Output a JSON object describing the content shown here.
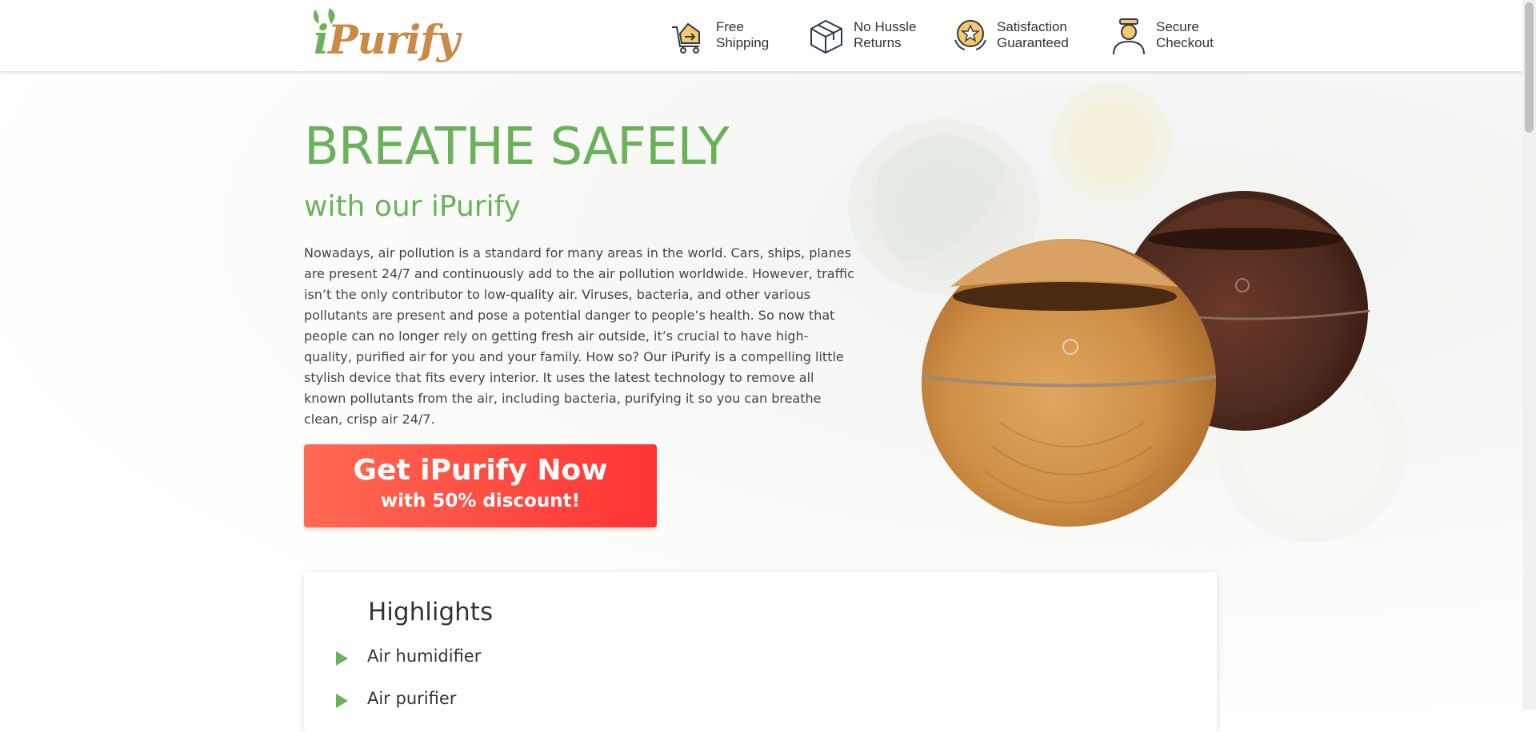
{
  "header": {
    "logo_text_i": "i",
    "logo_text_rest": "Purify",
    "features": [
      {
        "icon": "shipping-cart-icon",
        "line1": "Free",
        "line2": "Shipping"
      },
      {
        "icon": "box-icon",
        "line1": "No Hussle",
        "line2": "Returns"
      },
      {
        "icon": "badge-star-icon",
        "line1": "Satisfaction",
        "line2": "Guaranteed"
      },
      {
        "icon": "user-checkout-icon",
        "line1": "Secure",
        "line2": "Checkout"
      }
    ]
  },
  "hero": {
    "title": "BREATHE SAFELY",
    "subtitle": "with our iPurify",
    "description": "Nowadays, air pollution is a standard for many areas in the world. Cars, ships, planes are present 24/7 and continuously add to the air pollution worldwide. However, traffic isn’t the only contributor to low-quality air. Viruses, bacteria, and other various pollutants are present and pose a potential danger to people’s health. So now that people can no longer rely on getting fresh air outside, it’s crucial to have high-quality, purified air for you and your family. How so? Our iPurify is a compelling little stylish device that fits every interior. It uses the latest technology to remove all known pollutants from the air, including bacteria, purifying it so you can breathe clean, crisp air 24/7.",
    "cta_line1": "Get iPurify Now",
    "cta_line2": "with 50% discount!"
  },
  "highlights": {
    "title": "Highlights",
    "items": [
      "Air humidifier",
      "Air purifier"
    ]
  },
  "colors": {
    "accent_green": "#6bb15c",
    "cta_start": "#ff6a52",
    "cta_end": "#ff3434",
    "logo_orange": "#c98a45"
  }
}
